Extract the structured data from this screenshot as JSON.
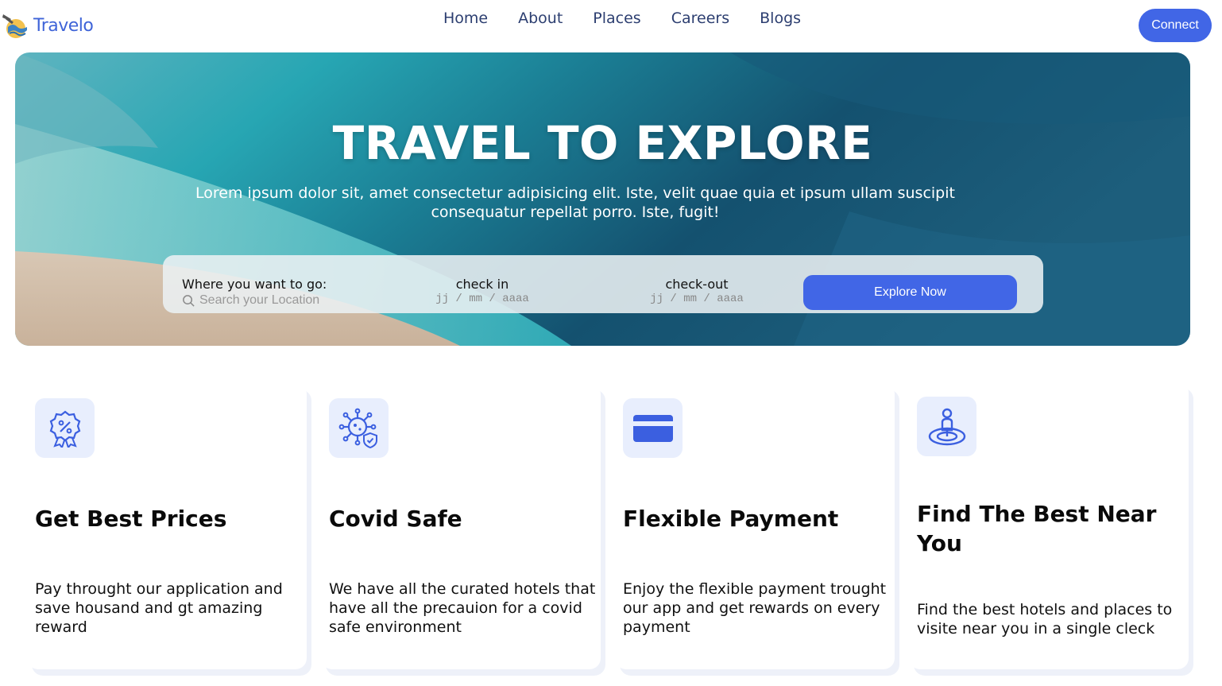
{
  "brand": {
    "name": "Travelo",
    "logo_icon": "globe-plane-icon"
  },
  "nav": {
    "links": [
      {
        "label": "Home"
      },
      {
        "label": "About"
      },
      {
        "label": "Places"
      },
      {
        "label": "Careers"
      },
      {
        "label": "Blogs"
      }
    ],
    "connect_label": "Connect"
  },
  "hero": {
    "title": "TRAVEL TO EXPLORE",
    "subtitle": "Lorem ipsum dolor sit, amet consectetur adipisicing elit. Iste, velit quae quia et ipsum ullam suscipit consequatur repellat porro. Iste, fugit!",
    "search": {
      "location_label": "Where you want to go:",
      "location_placeholder": "Search your Location",
      "checkin_label": "check in",
      "checkin_value": "jj / mm / aaaa",
      "checkout_label": "check-out",
      "checkout_value": "jj / mm / aaaa",
      "explore_label": "Explore Now"
    }
  },
  "features": [
    {
      "icon": "discount-badge-icon",
      "title": "Get Best Prices",
      "description": "Pay throught our application and save housand and gt amazing reward"
    },
    {
      "icon": "virus-shield-icon",
      "title": "Covid Safe",
      "description": "We have all the curated hotels that have all the precauion for a covid safe environment"
    },
    {
      "icon": "credit-card-icon",
      "title": "Flexible Payment",
      "description": "Enjoy the flexible payment trought our app and get rewards on every payment"
    },
    {
      "icon": "location-pin-person-icon",
      "title": "Find The Best Near You",
      "description": "Find the best hotels and places to visite near you in a single cleck"
    }
  ],
  "colors": {
    "accent": "#4166e6",
    "icon_bg": "#e8eefd",
    "nav_text": "#2c3e70"
  }
}
